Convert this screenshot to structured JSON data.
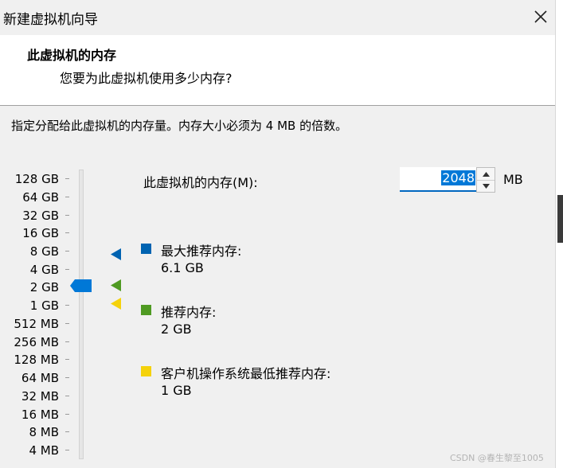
{
  "window": {
    "title": "新建虚拟机向导",
    "close_icon": "close-icon"
  },
  "header": {
    "title": "此虚拟机的内存",
    "subtitle": "您要为此虚拟机使用多少内存?"
  },
  "instruction": "指定分配给此虚拟机的内存量。内存大小必须为 4 MB 的倍数。",
  "slider": {
    "labels": [
      "128 GB",
      "64 GB",
      "32 GB",
      "16 GB",
      "8 GB",
      "4 GB",
      "2 GB",
      "1 GB",
      "512 MB",
      "256 MB",
      "128 MB",
      "64 MB",
      "32 MB",
      "16 MB",
      "8 MB",
      "4 MB"
    ],
    "selected": "2 GB",
    "thumb_color": "#0078d7"
  },
  "memory": {
    "label": "此虚拟机的内存(M):",
    "value": "2048",
    "unit": "MB"
  },
  "legend": {
    "max": {
      "label": "最大推荐内存:",
      "value": "6.1 GB",
      "color": "#0063b1"
    },
    "recommended": {
      "label": "推荐内存:",
      "value": "2 GB",
      "color": "#4f9a22"
    },
    "min": {
      "label": "客户机操作系统最低推荐内存:",
      "value": "1 GB",
      "color": "#f5d20b"
    }
  },
  "watermark": "CSDN @春生黎至1005"
}
